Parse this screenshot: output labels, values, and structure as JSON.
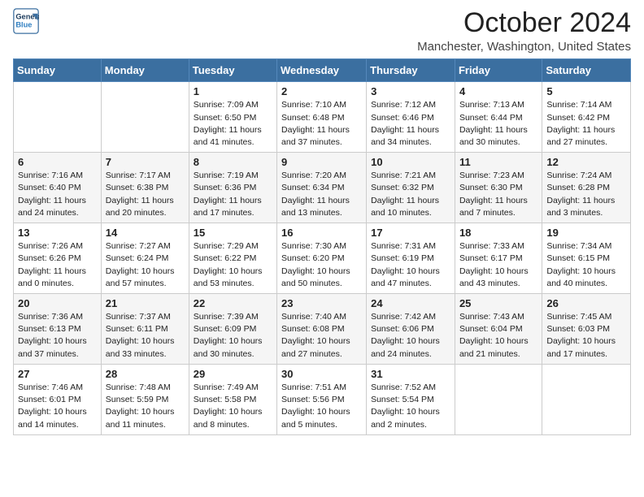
{
  "logo": {
    "line1": "General",
    "line2": "Blue"
  },
  "title": "October 2024",
  "location": "Manchester, Washington, United States",
  "days_of_week": [
    "Sunday",
    "Monday",
    "Tuesday",
    "Wednesday",
    "Thursday",
    "Friday",
    "Saturday"
  ],
  "weeks": [
    [
      {
        "num": "",
        "info": ""
      },
      {
        "num": "",
        "info": ""
      },
      {
        "num": "1",
        "info": "Sunrise: 7:09 AM\nSunset: 6:50 PM\nDaylight: 11 hours and 41 minutes."
      },
      {
        "num": "2",
        "info": "Sunrise: 7:10 AM\nSunset: 6:48 PM\nDaylight: 11 hours and 37 minutes."
      },
      {
        "num": "3",
        "info": "Sunrise: 7:12 AM\nSunset: 6:46 PM\nDaylight: 11 hours and 34 minutes."
      },
      {
        "num": "4",
        "info": "Sunrise: 7:13 AM\nSunset: 6:44 PM\nDaylight: 11 hours and 30 minutes."
      },
      {
        "num": "5",
        "info": "Sunrise: 7:14 AM\nSunset: 6:42 PM\nDaylight: 11 hours and 27 minutes."
      }
    ],
    [
      {
        "num": "6",
        "info": "Sunrise: 7:16 AM\nSunset: 6:40 PM\nDaylight: 11 hours and 24 minutes."
      },
      {
        "num": "7",
        "info": "Sunrise: 7:17 AM\nSunset: 6:38 PM\nDaylight: 11 hours and 20 minutes."
      },
      {
        "num": "8",
        "info": "Sunrise: 7:19 AM\nSunset: 6:36 PM\nDaylight: 11 hours and 17 minutes."
      },
      {
        "num": "9",
        "info": "Sunrise: 7:20 AM\nSunset: 6:34 PM\nDaylight: 11 hours and 13 minutes."
      },
      {
        "num": "10",
        "info": "Sunrise: 7:21 AM\nSunset: 6:32 PM\nDaylight: 11 hours and 10 minutes."
      },
      {
        "num": "11",
        "info": "Sunrise: 7:23 AM\nSunset: 6:30 PM\nDaylight: 11 hours and 7 minutes."
      },
      {
        "num": "12",
        "info": "Sunrise: 7:24 AM\nSunset: 6:28 PM\nDaylight: 11 hours and 3 minutes."
      }
    ],
    [
      {
        "num": "13",
        "info": "Sunrise: 7:26 AM\nSunset: 6:26 PM\nDaylight: 11 hours and 0 minutes."
      },
      {
        "num": "14",
        "info": "Sunrise: 7:27 AM\nSunset: 6:24 PM\nDaylight: 10 hours and 57 minutes."
      },
      {
        "num": "15",
        "info": "Sunrise: 7:29 AM\nSunset: 6:22 PM\nDaylight: 10 hours and 53 minutes."
      },
      {
        "num": "16",
        "info": "Sunrise: 7:30 AM\nSunset: 6:20 PM\nDaylight: 10 hours and 50 minutes."
      },
      {
        "num": "17",
        "info": "Sunrise: 7:31 AM\nSunset: 6:19 PM\nDaylight: 10 hours and 47 minutes."
      },
      {
        "num": "18",
        "info": "Sunrise: 7:33 AM\nSunset: 6:17 PM\nDaylight: 10 hours and 43 minutes."
      },
      {
        "num": "19",
        "info": "Sunrise: 7:34 AM\nSunset: 6:15 PM\nDaylight: 10 hours and 40 minutes."
      }
    ],
    [
      {
        "num": "20",
        "info": "Sunrise: 7:36 AM\nSunset: 6:13 PM\nDaylight: 10 hours and 37 minutes."
      },
      {
        "num": "21",
        "info": "Sunrise: 7:37 AM\nSunset: 6:11 PM\nDaylight: 10 hours and 33 minutes."
      },
      {
        "num": "22",
        "info": "Sunrise: 7:39 AM\nSunset: 6:09 PM\nDaylight: 10 hours and 30 minutes."
      },
      {
        "num": "23",
        "info": "Sunrise: 7:40 AM\nSunset: 6:08 PM\nDaylight: 10 hours and 27 minutes."
      },
      {
        "num": "24",
        "info": "Sunrise: 7:42 AM\nSunset: 6:06 PM\nDaylight: 10 hours and 24 minutes."
      },
      {
        "num": "25",
        "info": "Sunrise: 7:43 AM\nSunset: 6:04 PM\nDaylight: 10 hours and 21 minutes."
      },
      {
        "num": "26",
        "info": "Sunrise: 7:45 AM\nSunset: 6:03 PM\nDaylight: 10 hours and 17 minutes."
      }
    ],
    [
      {
        "num": "27",
        "info": "Sunrise: 7:46 AM\nSunset: 6:01 PM\nDaylight: 10 hours and 14 minutes."
      },
      {
        "num": "28",
        "info": "Sunrise: 7:48 AM\nSunset: 5:59 PM\nDaylight: 10 hours and 11 minutes."
      },
      {
        "num": "29",
        "info": "Sunrise: 7:49 AM\nSunset: 5:58 PM\nDaylight: 10 hours and 8 minutes."
      },
      {
        "num": "30",
        "info": "Sunrise: 7:51 AM\nSunset: 5:56 PM\nDaylight: 10 hours and 5 minutes."
      },
      {
        "num": "31",
        "info": "Sunrise: 7:52 AM\nSunset: 5:54 PM\nDaylight: 10 hours and 2 minutes."
      },
      {
        "num": "",
        "info": ""
      },
      {
        "num": "",
        "info": ""
      }
    ]
  ]
}
